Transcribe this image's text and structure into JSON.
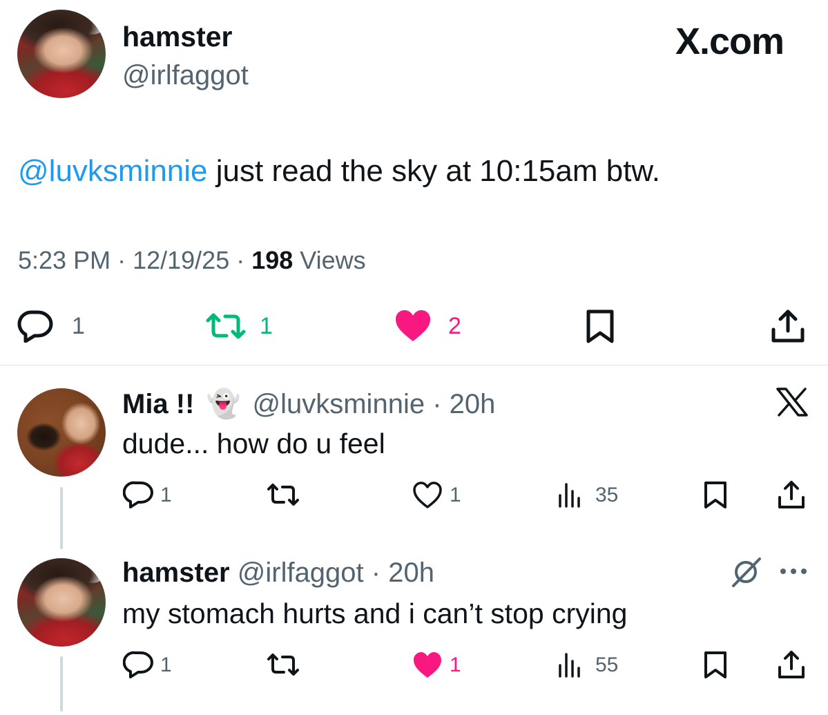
{
  "main_post": {
    "display_name": "hamster",
    "handle": "@irlfaggot",
    "brand": "X.com",
    "mention": "@luvksminnie",
    "text": " just read the sky at 10:15am btw.",
    "time": "5:23 PM",
    "sep1": " · ",
    "date": "12/19/25",
    "sep2": " · ",
    "views_count": "198",
    "views_label": " Views",
    "actions": {
      "replies": "1",
      "reposts": "1",
      "likes": "2"
    },
    "colors": {
      "repost": "#00ba7c",
      "like": "#f91880",
      "mention": "#1d9bf0"
    }
  },
  "replies": [
    {
      "display_name": "Mia !!",
      "emoji": "👻",
      "handle": "@luvksminnie",
      "sep": " · ",
      "time": "20h",
      "text": "dude... how do u feel",
      "actions": {
        "replies": "1",
        "likes": "1",
        "views": "35"
      },
      "liked": false,
      "corner_icon": "x-logo-icon"
    },
    {
      "display_name": "hamster",
      "handle": "@irlfaggot",
      "sep": " · ",
      "time": "20h",
      "text": "my stomach hurts and i can’t stop crying",
      "actions": {
        "replies": "1",
        "likes": "1",
        "views": "55"
      },
      "liked": true,
      "corner_icons": [
        "grok-icon",
        "more-icon"
      ]
    }
  ]
}
